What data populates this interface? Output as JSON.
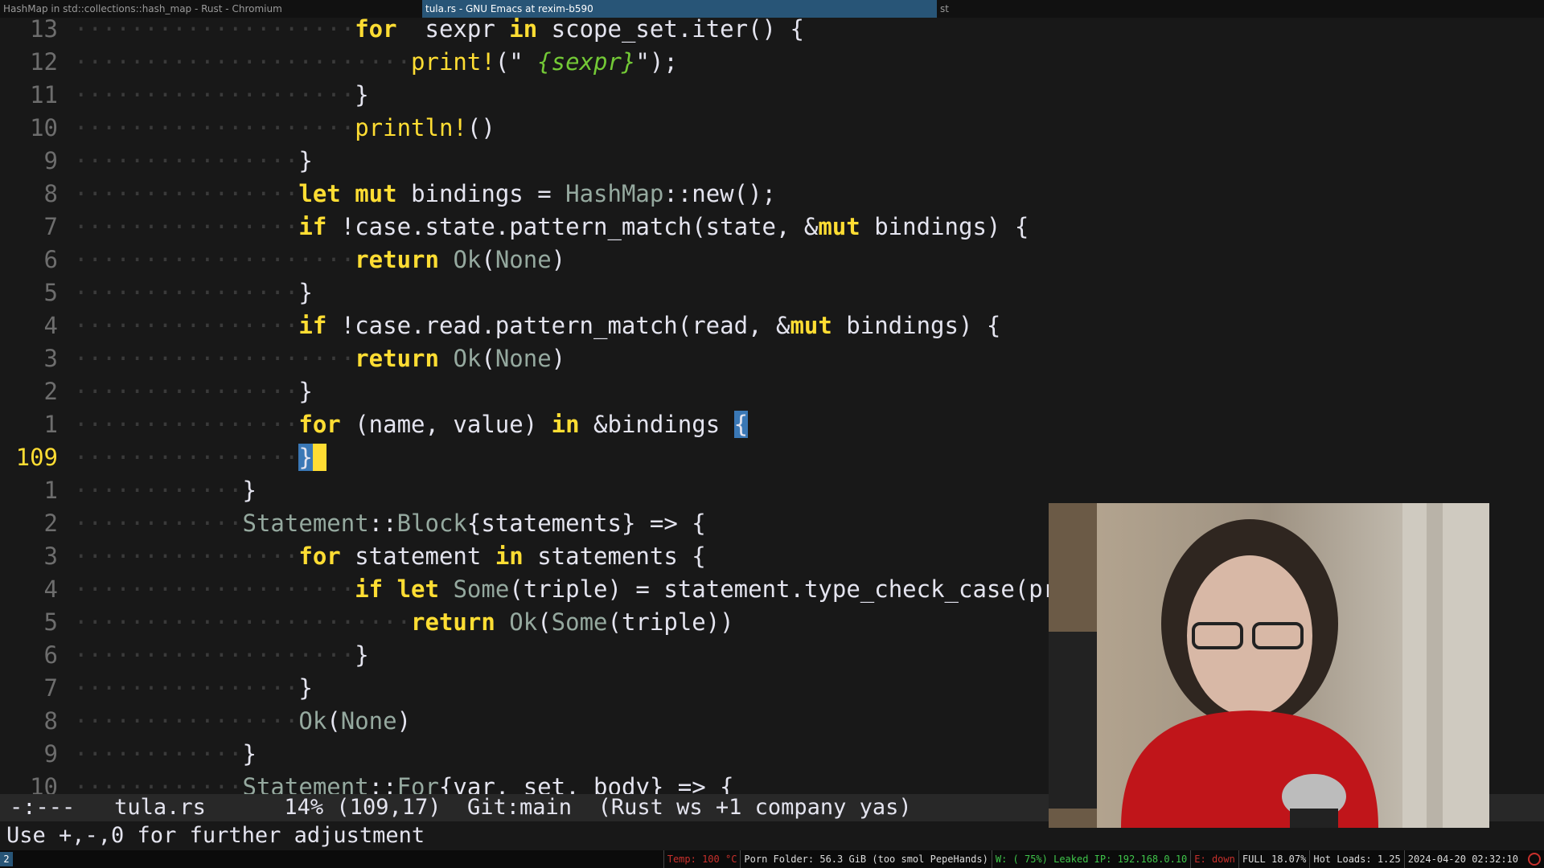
{
  "taskbar": {
    "tabs": [
      {
        "label": "HashMap in std::collections::hash_map - Rust - Chromium",
        "active": false
      },
      {
        "label": "tula.rs - GNU Emacs at rexim-b590",
        "active": true
      },
      {
        "label": "st",
        "active": false
      }
    ]
  },
  "editor": {
    "lines": [
      {
        "num": "13",
        "indent": 5,
        "tokens": [
          [
            "kw",
            "for"
          ],
          [
            "",
            "  sexpr "
          ],
          [
            "kw",
            "in"
          ],
          [
            "",
            " scope_set.iter() {"
          ]
        ]
      },
      {
        "num": "12",
        "indent": 6,
        "tokens": [
          [
            "mac",
            "print!"
          ],
          [
            "",
            "(\""
          ],
          [
            "strv",
            " {sexpr}"
          ],
          [
            "",
            "\");"
          ]
        ]
      },
      {
        "num": "11",
        "indent": 5,
        "tokens": [
          [
            "",
            "}"
          ]
        ]
      },
      {
        "num": "10",
        "indent": 5,
        "tokens": [
          [
            "mac",
            "println!"
          ],
          [
            "",
            "()"
          ]
        ]
      },
      {
        "num": "9",
        "indent": 4,
        "tokens": [
          [
            "",
            "}"
          ]
        ]
      },
      {
        "num": "8",
        "indent": 4,
        "tokens": [
          [
            "kw",
            "let"
          ],
          [
            "",
            " "
          ],
          [
            "kw",
            "mut"
          ],
          [
            "",
            " bindings = "
          ],
          [
            "ty",
            "HashMap"
          ],
          [
            "",
            "::new();"
          ]
        ]
      },
      {
        "num": "7",
        "indent": 4,
        "tokens": [
          [
            "kw",
            "if"
          ],
          [
            "",
            " !case.state.pattern_match(state, &"
          ],
          [
            "kw",
            "mut"
          ],
          [
            "",
            " bindings) {"
          ]
        ]
      },
      {
        "num": "6",
        "indent": 5,
        "tokens": [
          [
            "kw",
            "return"
          ],
          [
            "",
            " "
          ],
          [
            "ty",
            "Ok"
          ],
          [
            "",
            "("
          ],
          [
            "ty",
            "None"
          ],
          [
            "",
            ")"
          ]
        ]
      },
      {
        "num": "5",
        "indent": 4,
        "tokens": [
          [
            "",
            "}"
          ]
        ]
      },
      {
        "num": "4",
        "indent": 4,
        "tokens": [
          [
            "kw",
            "if"
          ],
          [
            "",
            " !case.read.pattern_match(read, &"
          ],
          [
            "kw",
            "mut"
          ],
          [
            "",
            " bindings) {"
          ]
        ]
      },
      {
        "num": "3",
        "indent": 5,
        "tokens": [
          [
            "kw",
            "return"
          ],
          [
            "",
            " "
          ],
          [
            "ty",
            "Ok"
          ],
          [
            "",
            "("
          ],
          [
            "ty",
            "None"
          ],
          [
            "",
            ")"
          ]
        ]
      },
      {
        "num": "2",
        "indent": 4,
        "tokens": [
          [
            "",
            "}"
          ]
        ]
      },
      {
        "num": "1",
        "indent": 4,
        "tokens": [
          [
            "kw",
            "for"
          ],
          [
            "",
            " (name, value) "
          ],
          [
            "kw",
            "in"
          ],
          [
            "",
            " &bindings "
          ],
          [
            "hl",
            "{"
          ]
        ]
      },
      {
        "num": "109",
        "indent": 4,
        "current": true,
        "tokens": [
          [
            "hl",
            "}"
          ],
          [
            "cursor",
            " "
          ]
        ]
      },
      {
        "num": "1",
        "indent": 3,
        "tokens": [
          [
            "",
            "}"
          ]
        ]
      },
      {
        "num": "2",
        "indent": 3,
        "tokens": [
          [
            "ty",
            "Statement"
          ],
          [
            "",
            "::"
          ],
          [
            "ty",
            "Block"
          ],
          [
            "",
            "{statements} => {"
          ]
        ]
      },
      {
        "num": "3",
        "indent": 4,
        "tokens": [
          [
            "kw",
            "for"
          ],
          [
            "",
            " statement "
          ],
          [
            "kw",
            "in"
          ],
          [
            "",
            " statements {"
          ]
        ]
      },
      {
        "num": "4",
        "indent": 5,
        "tokens": [
          [
            "kw",
            "if"
          ],
          [
            "",
            " "
          ],
          [
            "kw",
            "let"
          ],
          [
            "",
            " "
          ],
          [
            "ty",
            "Some"
          ],
          [
            "",
            "(triple) = statement.type_check_case(program,"
          ]
        ]
      },
      {
        "num": "5",
        "indent": 6,
        "tokens": [
          [
            "kw",
            "return"
          ],
          [
            "",
            " "
          ],
          [
            "ty",
            "Ok"
          ],
          [
            "",
            "("
          ],
          [
            "ty",
            "Some"
          ],
          [
            "",
            "(triple))"
          ]
        ]
      },
      {
        "num": "6",
        "indent": 5,
        "tokens": [
          [
            "",
            "}"
          ]
        ]
      },
      {
        "num": "7",
        "indent": 4,
        "tokens": [
          [
            "",
            "}"
          ]
        ]
      },
      {
        "num": "8",
        "indent": 4,
        "tokens": [
          [
            "ty",
            "Ok"
          ],
          [
            "",
            "("
          ],
          [
            "ty",
            "None"
          ],
          [
            "",
            ")"
          ]
        ]
      },
      {
        "num": "9",
        "indent": 3,
        "tokens": [
          [
            "",
            "}"
          ]
        ]
      },
      {
        "num": "10",
        "indent": 3,
        "tokens": [
          [
            "ty",
            "Statement"
          ],
          [
            "",
            "::"
          ],
          [
            "ty",
            "For"
          ],
          [
            "",
            "{var, set, body} => {"
          ]
        ]
      }
    ]
  },
  "modeline": {
    "status": "-:---",
    "buffer": "tula.rs",
    "position": "14% (109,17)",
    "vc": "Git:main",
    "modes": "(Rust ws +1 company yas)"
  },
  "echo": "Use +,-,0 for further adjustment",
  "statusbar": {
    "workspace": "2",
    "blocks": [
      {
        "text": "Temp: 100 °C",
        "color": "red"
      },
      {
        "text": "Porn Folder: 56.3 GiB (too smol PepeHands)",
        "color": "normal"
      },
      {
        "text": "W: ( 75%) Leaked IP: 192.168.0.10",
        "color": "green"
      },
      {
        "text": "E: down",
        "color": "red"
      },
      {
        "text": "FULL 18.07%",
        "color": "normal"
      },
      {
        "text": "Hot Loads: 1.25",
        "color": "normal"
      },
      {
        "text": "2024-04-20 02:32:10",
        "color": "normal"
      }
    ]
  },
  "colors": {
    "background": "#181818",
    "keyword": "#ffdd33",
    "type": "#95a99f",
    "string": "#73c936",
    "highlight": "#3a78b6",
    "active_tab": "#285577"
  }
}
